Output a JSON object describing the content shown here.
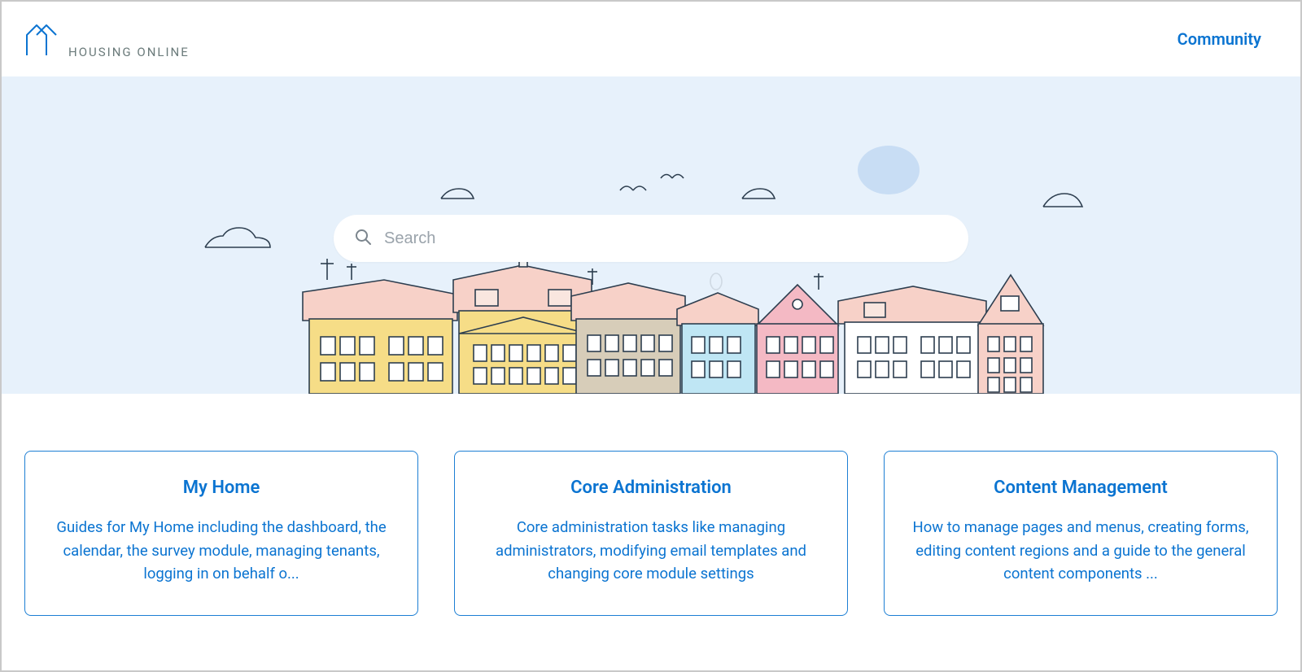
{
  "header": {
    "brand_name": "HOUSING ONLINE",
    "community_label": "Community"
  },
  "search": {
    "placeholder": "Search",
    "value": ""
  },
  "cards": [
    {
      "title": "My Home",
      "description": "Guides for My Home including the dashboard, the calendar, the survey module, managing tenants, logging in on behalf o..."
    },
    {
      "title": "Core Administration",
      "description": "Core administration tasks like managing administrators, modifying email templates and changing core module settings"
    },
    {
      "title": "Content Management",
      "description": "How to manage pages and menus, creating forms, editing content regions and a guide to the general content components ..."
    }
  ],
  "colors": {
    "link_blue": "#0b74d1",
    "hero_bg": "#e7f1fb"
  }
}
